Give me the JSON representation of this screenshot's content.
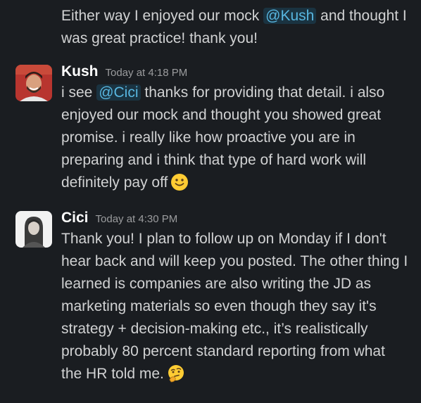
{
  "continuation": {
    "line1_pre": "Either way I enjoyed our mock ",
    "line1_mention": "@Kush",
    "line1_post": " and thought I",
    "line2": "was great practice! thank you!"
  },
  "messages": [
    {
      "author": "Kush",
      "time": "Today at 4:18 PM",
      "avatar_icon": "person-avatar-icon",
      "line1_pre": "i see ",
      "line1_mention": "@Cici",
      "line1_post": " thanks for providing that detail. i also",
      "line2": "enjoyed our mock and thought you showed great",
      "line3": "promise. i really like how proactive you are in",
      "line4": "preparing and i think that type of hard work will",
      "line5": "definitely pay off",
      "emoji": "slightly-smiling-face-emoji"
    },
    {
      "author": "Cici",
      "time": "Today at 4:30 PM",
      "avatar_icon": "person-avatar-icon",
      "line1": "Thank you! I plan to follow up on Monday if I don't",
      "line2": "hear back and will keep you posted. The other thing I",
      "line3": "learned is companies are also writing the JD as",
      "line4": "marketing materials so even though they say it's",
      "line5": "strategy + decision-making etc., it’s realistically",
      "line6": "probably 80 percent standard reporting from what",
      "line7": "the HR told me.",
      "emoji": "thinking-face-emoji"
    }
  ],
  "colors": {
    "background": "#1a1d21",
    "text": "#d1d2d3",
    "mention_text": "#58b6e0",
    "timestamp": "#9b9c9e"
  }
}
